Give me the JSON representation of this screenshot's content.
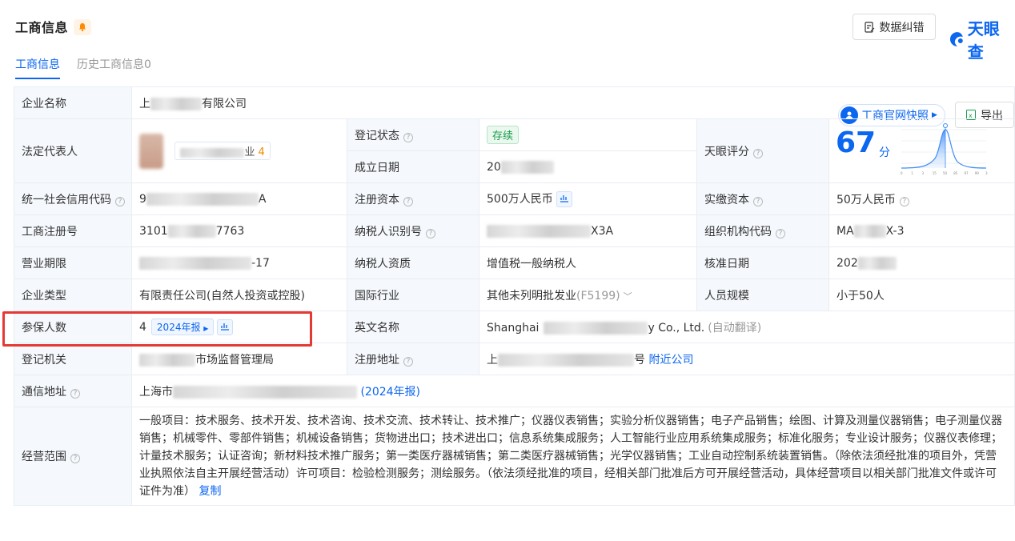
{
  "header": {
    "title": "工商信息",
    "correct_label": "数据纠错",
    "logo_text": "天眼查"
  },
  "tabs": {
    "active": "工商信息",
    "history": "历史工商信息0"
  },
  "actions": {
    "snapshot": "工商官网快照",
    "export": "导出"
  },
  "rows": {
    "company_name": {
      "label": "企业名称",
      "value_prefix": "上",
      "value_suffix": "有限公司"
    },
    "legal_rep": {
      "label": "法定代表人",
      "tag_suffix": "业",
      "tag_count": "4"
    },
    "reg_status": {
      "label": "登记状态",
      "value": "存续"
    },
    "est_date": {
      "label": "成立日期",
      "value_prefix": "20"
    },
    "tianyan_score": {
      "label": "天眼评分",
      "score": "67",
      "unit": "分",
      "ticks": [
        "0",
        "1",
        "3",
        "15",
        "50",
        "85",
        "97",
        "99",
        "100"
      ]
    },
    "credit_code": {
      "label": "统一社会信用代码",
      "value_prefix": "9",
      "value_suffix": "A"
    },
    "reg_capital": {
      "label": "注册资本",
      "value": "500万人民币"
    },
    "paid_capital": {
      "label": "实缴资本",
      "value": "50万人民币"
    },
    "reg_no": {
      "label": "工商注册号",
      "value_prefix": "3101",
      "value_suffix": "7763"
    },
    "taxpayer_id": {
      "label": "纳税人识别号",
      "value_suffix": "X3A"
    },
    "org_code": {
      "label": "组织机构代码",
      "value_prefix": "MA",
      "value_suffix": "X-3"
    },
    "business_term": {
      "label": "营业期限",
      "value_suffix": "-17"
    },
    "taxpayer_type": {
      "label": "纳税人资质",
      "value": "增值税一般纳税人"
    },
    "approval_date": {
      "label": "核准日期",
      "value_prefix": "202"
    },
    "company_type": {
      "label": "企业类型",
      "value": "有限责任公司(自然人投资或控股)"
    },
    "industry": {
      "label": "国际行业",
      "value": "其他未列明批发业",
      "code": "(F5199)"
    },
    "staff_size": {
      "label": "人员规模",
      "value": "小于50人"
    },
    "insured": {
      "label": "参保人数",
      "value": "4",
      "report": "2024年报"
    },
    "english_name": {
      "label": "英文名称",
      "value_prefix": "Shanghai",
      "value_suffix": "y Co., Ltd.",
      "auto": "(自动翻译)"
    },
    "reg_authority": {
      "label": "登记机关",
      "value_suffix": "市场监督管理局"
    },
    "reg_address": {
      "label": "注册地址",
      "value_prefix": "上",
      "value_suffix": "号",
      "nearby": "附近公司"
    },
    "mail_address": {
      "label": "通信地址",
      "value_prefix": "上海市",
      "report": "(2024年报)"
    },
    "scope": {
      "label": "经营范围",
      "text": "一般项目：技术服务、技术开发、技术咨询、技术交流、技术转让、技术推广；仪器仪表销售；实验分析仪器销售；电子产品销售；绘图、计算及测量仪器销售；电子测量仪器销售；机械零件、零部件销售；机械设备销售；货物进出口；技术进出口；信息系统集成服务；人工智能行业应用系统集成服务；标准化服务；专业设计服务；仪器仪表修理；计量技术服务；认证咨询；新材料技术推广服务；第一类医疗器械销售；第二类医疗器械销售；光学仪器销售；工业自动控制系统装置销售。（除依法须经批准的项目外，凭营业执照依法自主开展经营活动）许可项目：检验检测服务；测绘服务。（依法须经批准的项目，经相关部门批准后方可开展经营活动，具体经营项目以相关部门批准文件或许可证件为准）",
      "copy": "复制"
    }
  }
}
